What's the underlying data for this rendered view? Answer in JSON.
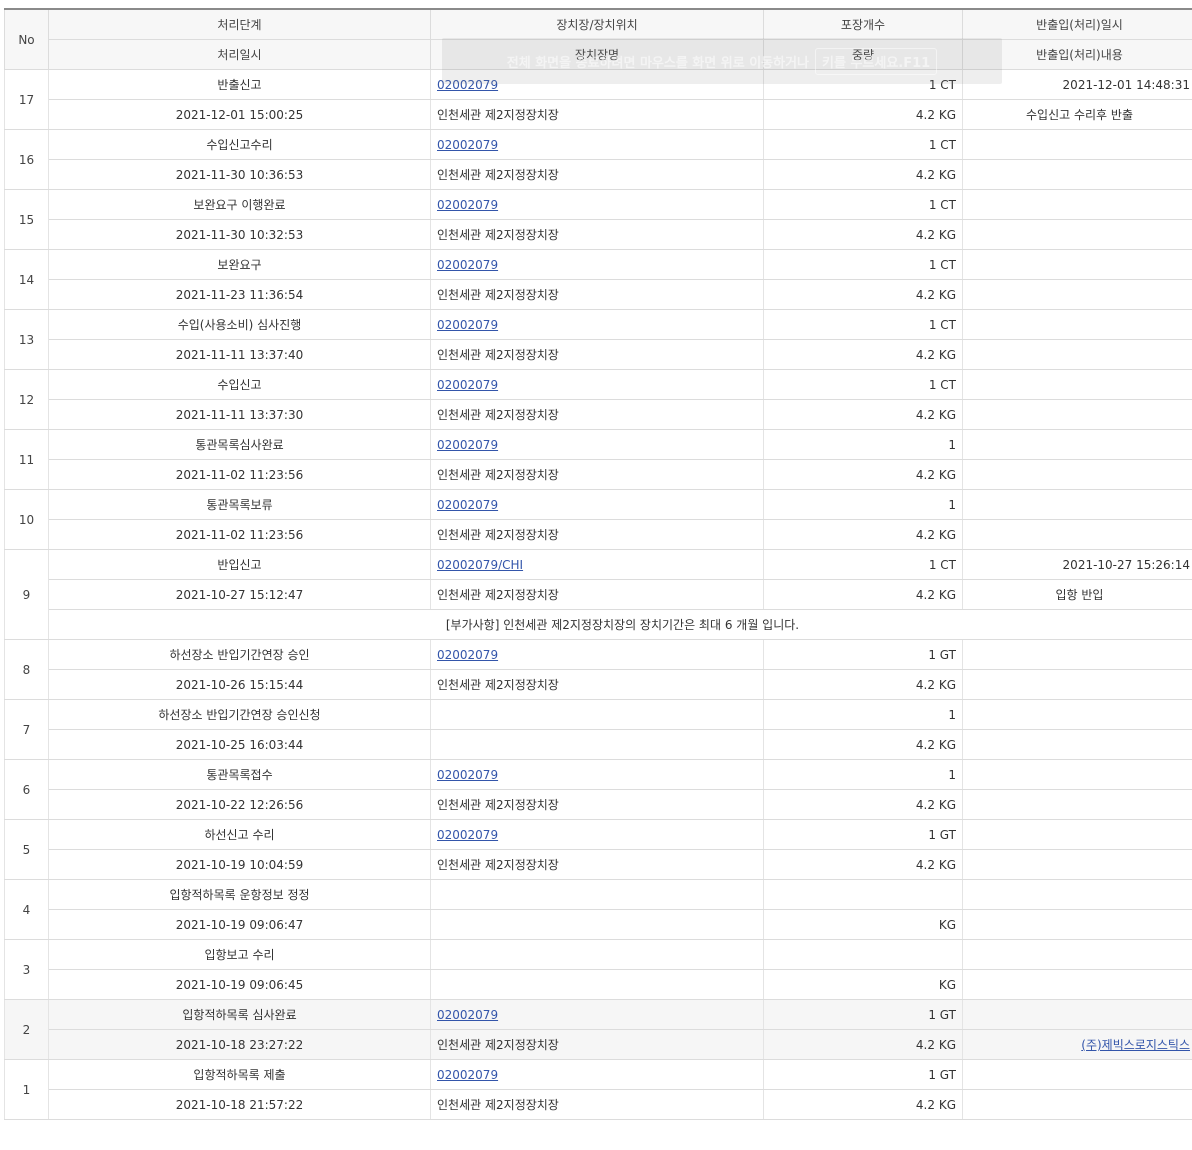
{
  "header": {
    "no": "No",
    "stage": "처리단계",
    "date": "처리일시",
    "location": "장치장/장치위치",
    "location_name": "장치장명",
    "count": "포장개수",
    "weight": "중량",
    "io_datetime": "반출입(처리)일시",
    "io_content": "반출입(처리)내용"
  },
  "toast": {
    "text": "전체 화면을 종료하려면 마우스를 화면 위로 이동하거나",
    "key": "키를 누르세요.F11"
  },
  "records": [
    {
      "no": "17",
      "stage": "반출신고",
      "date": "2021-12-01 15:00:25",
      "code": "02002079",
      "loc": "인천세관 제2지정장치장",
      "count": "1 CT",
      "weight": "4.2 KG",
      "io_dt": "2021-12-01 14:48:31",
      "io": "수입신고 수리후 반출"
    },
    {
      "no": "16",
      "stage": "수입신고수리",
      "date": "2021-11-30 10:36:53",
      "code": "02002079",
      "loc": "인천세관 제2지정장치장",
      "count": "1 CT",
      "weight": "4.2 KG",
      "io_dt": "",
      "io": ""
    },
    {
      "no": "15",
      "stage": "보완요구 이행완료",
      "date": "2021-11-30 10:32:53",
      "code": "02002079",
      "loc": "인천세관 제2지정장치장",
      "count": "1 CT",
      "weight": "4.2 KG",
      "io_dt": "",
      "io": ""
    },
    {
      "no": "14",
      "stage": "보완요구",
      "date": "2021-11-23 11:36:54",
      "code": "02002079",
      "loc": "인천세관 제2지정장치장",
      "count": "1 CT",
      "weight": "4.2 KG",
      "io_dt": "",
      "io": ""
    },
    {
      "no": "13",
      "stage": "수입(사용소비) 심사진행",
      "date": "2021-11-11 13:37:40",
      "code": "02002079",
      "loc": "인천세관 제2지정장치장",
      "count": "1 CT",
      "weight": "4.2 KG",
      "io_dt": "",
      "io": ""
    },
    {
      "no": "12",
      "stage": "수입신고",
      "date": "2021-11-11 13:37:30",
      "code": "02002079",
      "loc": "인천세관 제2지정장치장",
      "count": "1 CT",
      "weight": "4.2 KG",
      "io_dt": "",
      "io": ""
    },
    {
      "no": "11",
      "stage": "통관목록심사완료",
      "date": "2021-11-02 11:23:56",
      "code": "02002079",
      "loc": "인천세관 제2지정장치장",
      "count": "1",
      "weight": "4.2 KG",
      "io_dt": "",
      "io": ""
    },
    {
      "no": "10",
      "stage": "통관목록보류",
      "date": "2021-11-02 11:23:56",
      "code": "02002079",
      "loc": "인천세관 제2지정장치장",
      "count": "1",
      "weight": "4.2 KG",
      "io_dt": "",
      "io": ""
    },
    {
      "no": "9",
      "stage": "반입신고",
      "date": "2021-10-27 15:12:47",
      "code": "02002079/CHI",
      "loc": "인천세관 제2지정장치장",
      "count": "1 CT",
      "weight": "4.2 KG",
      "io_dt": "2021-10-27 15:26:14",
      "io": "입항 반입",
      "note": "[부가사항] 인천세관 제2지정장치장의 장치기간은 최대 6 개월 입니다."
    },
    {
      "no": "8",
      "stage": "하선장소 반입기간연장 승인",
      "date": "2021-10-26 15:15:44",
      "code": "02002079",
      "loc": "인천세관 제2지정장치장",
      "count": "1 GT",
      "weight": "4.2 KG",
      "io_dt": "",
      "io": ""
    },
    {
      "no": "7",
      "stage": "하선장소 반입기간연장 승인신청",
      "date": "2021-10-25 16:03:44",
      "code": "",
      "loc": "",
      "count": "1",
      "weight": "4.2 KG",
      "io_dt": "",
      "io": ""
    },
    {
      "no": "6",
      "stage": "통관목록접수",
      "date": "2021-10-22 12:26:56",
      "code": "02002079",
      "loc": "인천세관 제2지정장치장",
      "count": "1",
      "weight": "4.2 KG",
      "io_dt": "",
      "io": ""
    },
    {
      "no": "5",
      "stage": "하선신고 수리",
      "date": "2021-10-19 10:04:59",
      "code": "02002079",
      "loc": "인천세관 제2지정장치장",
      "count": "1 GT",
      "weight": "4.2 KG",
      "io_dt": "",
      "io": ""
    },
    {
      "no": "4",
      "stage": "입항적하목록 운항정보 정정",
      "date": "2021-10-19 09:06:47",
      "code": "",
      "loc": "",
      "count": "",
      "weight": "KG",
      "io_dt": "",
      "io": ""
    },
    {
      "no": "3",
      "stage": "입항보고 수리",
      "date": "2021-10-19 09:06:45",
      "code": "",
      "loc": "",
      "count": "",
      "weight": "KG",
      "io_dt": "",
      "io": ""
    },
    {
      "no": "2",
      "stage": "입항적하목록 심사완료",
      "date": "2021-10-18 23:27:22",
      "code": "02002079",
      "loc": "인천세관 제2지정장치장",
      "count": "1 GT",
      "weight": "4.2 KG",
      "io_dt": "",
      "io": "",
      "io_link": "(주)제빅스로지스틱스",
      "highlight": true
    },
    {
      "no": "1",
      "stage": "입항적하목록 제출",
      "date": "2021-10-18 21:57:22",
      "code": "02002079",
      "loc": "인천세관 제2지정장치장",
      "count": "1 GT",
      "weight": "4.2 KG",
      "io_dt": "",
      "io": ""
    }
  ]
}
